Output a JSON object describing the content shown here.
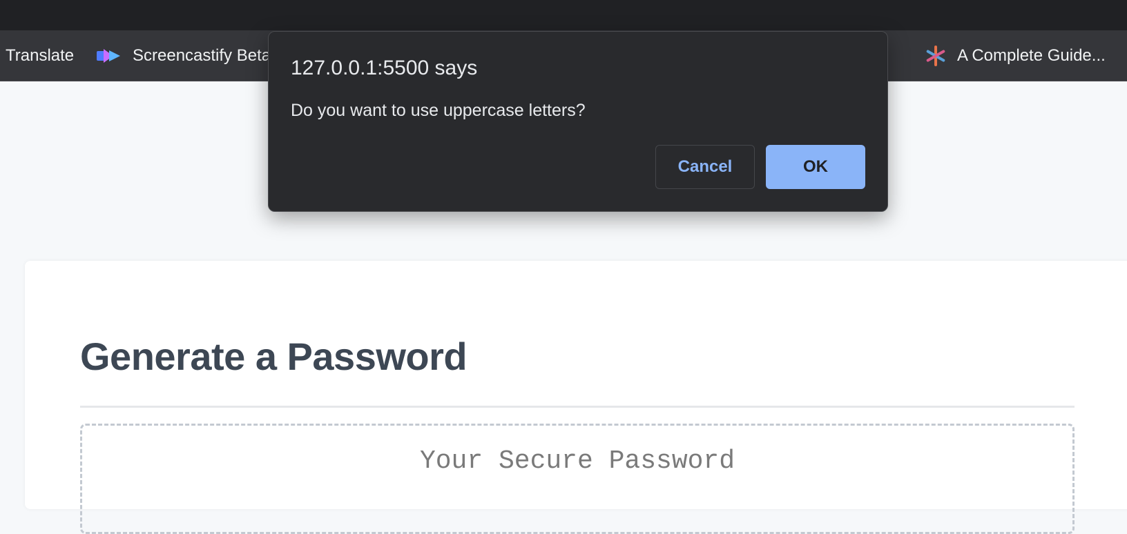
{
  "browser": {
    "bookmarks": [
      {
        "label": "Translate",
        "icon": "none"
      },
      {
        "label": "Screencastify Beta",
        "icon": "screencastify-icon"
      },
      {
        "label": "...",
        "icon": "none"
      },
      {
        "label": "A Complete Guide...",
        "icon": "asterisk-icon"
      }
    ]
  },
  "dialog": {
    "title": "127.0.0.1:5500 says",
    "message": "Do you want to use uppercase letters?",
    "cancel_label": "Cancel",
    "ok_label": "OK",
    "accent": "#8ab4f8"
  },
  "page": {
    "heading": "Generate a Password",
    "password_placeholder": "Your Secure Password"
  }
}
